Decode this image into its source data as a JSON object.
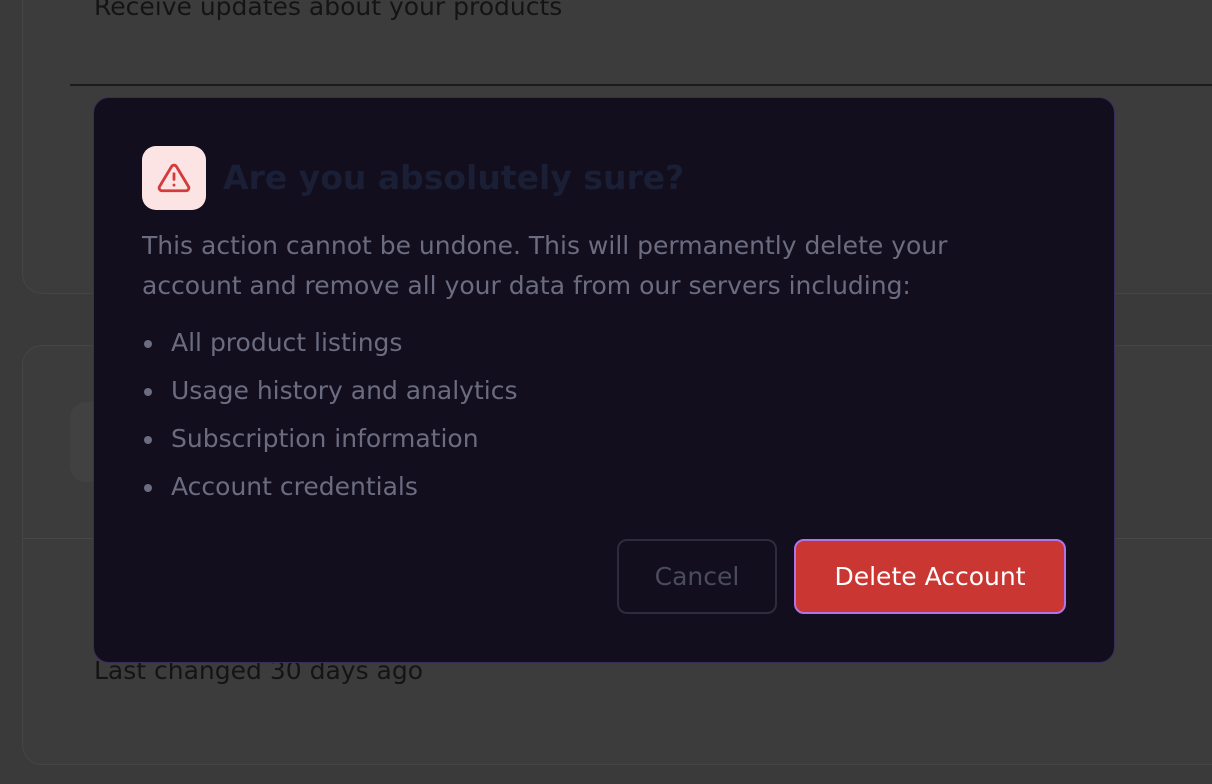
{
  "background": {
    "updates_text": "Receive updates about your products",
    "last_changed_text": "Last changed 30 days ago"
  },
  "dialog": {
    "icon": "warning-triangle-icon",
    "title": "Are you absolutely sure?",
    "description": "This action cannot be undone. This will permanently delete your account and remove all your data from our servers including:",
    "items": [
      "All product listings",
      "Usage history and analytics",
      "Subscription information",
      "Account credentials"
    ],
    "cancel_label": "Cancel",
    "delete_label": "Delete Account",
    "colors": {
      "danger": "#ca3733",
      "focus_ring": "#b373e8",
      "icon_bg": "#fde4e4",
      "surface": "#120e1e"
    }
  }
}
